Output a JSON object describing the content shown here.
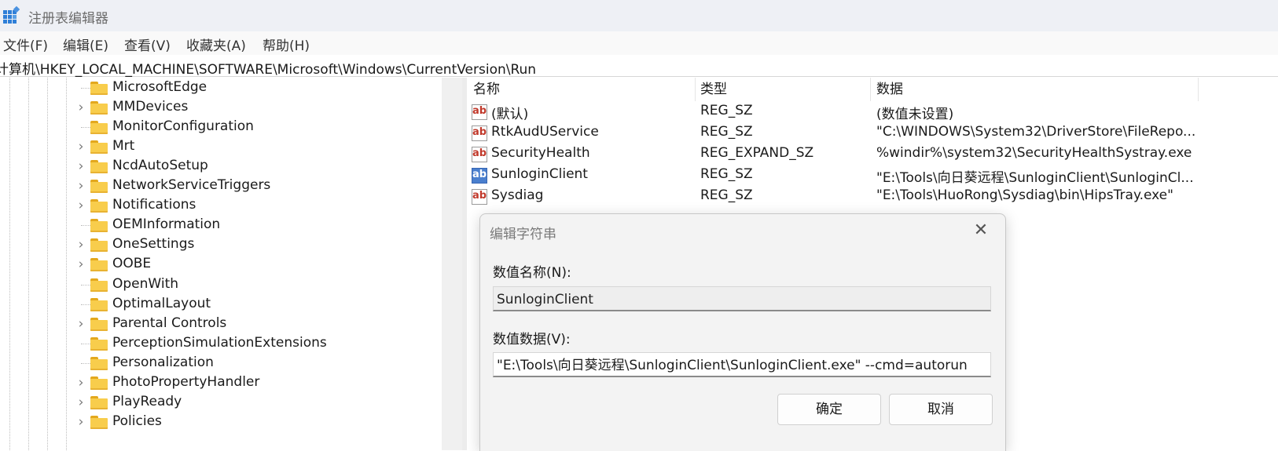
{
  "window": {
    "title": "注册表编辑器",
    "app_icon": "registry-editor-icon"
  },
  "menu": [
    {
      "label": "文件(F)"
    },
    {
      "label": "编辑(E)"
    },
    {
      "label": "查看(V)"
    },
    {
      "label": "收藏夹(A)"
    },
    {
      "label": "帮助(H)"
    }
  ],
  "address": {
    "path": "计算机\\HKEY_LOCAL_MACHINE\\SOFTWARE\\Microsoft\\Windows\\CurrentVersion\\Run"
  },
  "tree": {
    "items": [
      {
        "label": "MicrosoftEdge",
        "expandable": false
      },
      {
        "label": "MMDevices",
        "expandable": true
      },
      {
        "label": "MonitorConfiguration",
        "expandable": false
      },
      {
        "label": "Mrt",
        "expandable": true
      },
      {
        "label": "NcdAutoSetup",
        "expandable": true
      },
      {
        "label": "NetworkServiceTriggers",
        "expandable": true
      },
      {
        "label": "Notifications",
        "expandable": true
      },
      {
        "label": "OEMInformation",
        "expandable": false
      },
      {
        "label": "OneSettings",
        "expandable": true
      },
      {
        "label": "OOBE",
        "expandable": true
      },
      {
        "label": "OpenWith",
        "expandable": false
      },
      {
        "label": "OptimalLayout",
        "expandable": false
      },
      {
        "label": "Parental Controls",
        "expandable": true
      },
      {
        "label": "PerceptionSimulationExtensions",
        "expandable": false
      },
      {
        "label": "Personalization",
        "expandable": false
      },
      {
        "label": "PhotoPropertyHandler",
        "expandable": true
      },
      {
        "label": "PlayReady",
        "expandable": true
      },
      {
        "label": "Policies",
        "expandable": true
      }
    ]
  },
  "values_list": {
    "headers": {
      "name": "名称",
      "type": "类型",
      "data": "数据"
    },
    "rows": [
      {
        "name": "(默认)",
        "type": "REG_SZ",
        "data": "(数值未设置)",
        "icon": "string-value-icon"
      },
      {
        "name": "RtkAudUService",
        "type": "REG_SZ",
        "data": "\"C:\\WINDOWS\\System32\\DriverStore\\FileRepo...",
        "icon": "string-value-icon"
      },
      {
        "name": "SecurityHealth",
        "type": "REG_EXPAND_SZ",
        "data": "%windir%\\system32\\SecurityHealthSystray.exe",
        "icon": "string-value-icon"
      },
      {
        "name": "SunloginClient",
        "type": "REG_SZ",
        "data": "\"E:\\Tools\\向日葵远程\\SunloginClient\\SunloginCl...",
        "icon": "string-value-icon",
        "selected": true
      },
      {
        "name": "Sysdiag",
        "type": "REG_SZ",
        "data": "\"E:\\Tools\\HuoRong\\Sysdiag\\bin\\HipsTray.exe\"",
        "icon": "string-value-icon"
      }
    ]
  },
  "dialog": {
    "title": "编辑字符串",
    "name_label": "数值名称(N):",
    "name_value": "SunloginClient",
    "data_label": "数值数据(V):",
    "data_value": "\"E:\\Tools\\向日葵远程\\SunloginClient\\SunloginClient.exe\" --cmd=autorun",
    "ok_label": "确定",
    "cancel_label": "取消"
  }
}
